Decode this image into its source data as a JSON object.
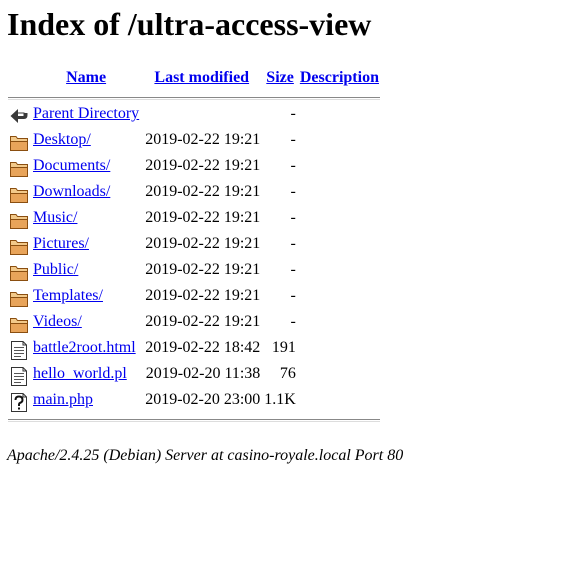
{
  "page": {
    "title": "Index of /ultra-access-view"
  },
  "table": {
    "headers": {
      "name": "Name",
      "last_modified": "Last modified",
      "size": "Size",
      "description": "Description"
    },
    "rows": [
      {
        "icon": "back-icon",
        "name": "Parent Directory",
        "modified": "",
        "size": "-",
        "description": ""
      },
      {
        "icon": "folder-icon",
        "name": "Desktop/",
        "modified": "2019-02-22 19:21",
        "size": "-",
        "description": ""
      },
      {
        "icon": "folder-icon",
        "name": "Documents/",
        "modified": "2019-02-22 19:21",
        "size": "-",
        "description": ""
      },
      {
        "icon": "folder-icon",
        "name": "Downloads/",
        "modified": "2019-02-22 19:21",
        "size": "-",
        "description": ""
      },
      {
        "icon": "folder-icon",
        "name": "Music/",
        "modified": "2019-02-22 19:21",
        "size": "-",
        "description": ""
      },
      {
        "icon": "folder-icon",
        "name": "Pictures/",
        "modified": "2019-02-22 19:21",
        "size": "-",
        "description": ""
      },
      {
        "icon": "folder-icon",
        "name": "Public/",
        "modified": "2019-02-22 19:21",
        "size": "-",
        "description": ""
      },
      {
        "icon": "folder-icon",
        "name": "Templates/",
        "modified": "2019-02-22 19:21",
        "size": "-",
        "description": ""
      },
      {
        "icon": "folder-icon",
        "name": "Videos/",
        "modified": "2019-02-22 19:21",
        "size": "-",
        "description": ""
      },
      {
        "icon": "text-file-icon",
        "name": "battle2root.html",
        "modified": "2019-02-22 18:42",
        "size": "191",
        "description": ""
      },
      {
        "icon": "text-file-icon",
        "name": "hello_world.pl",
        "modified": "2019-02-20 11:38",
        "size": "76",
        "description": ""
      },
      {
        "icon": "unknown-file-icon",
        "name": "main.php",
        "modified": "2019-02-20 23:00",
        "size": "1.1K",
        "description": ""
      }
    ]
  },
  "footer": {
    "signature": "Apache/2.4.25 (Debian) Server at casino-royale.local Port 80"
  },
  "colors": {
    "link": "#0000ee",
    "folder": "#d98a2b",
    "rule": "#888888"
  }
}
